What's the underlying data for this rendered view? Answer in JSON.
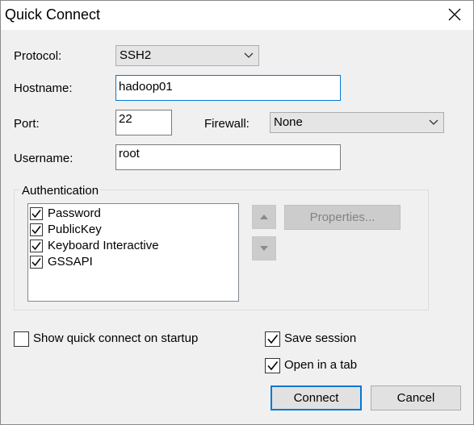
{
  "window": {
    "title": "Quick Connect"
  },
  "form": {
    "protocol_label": "Protocol:",
    "protocol_value": "SSH2",
    "hostname_label": "Hostname:",
    "hostname_value": "hadoop01",
    "port_label": "Port:",
    "port_value": "22",
    "firewall_label": "Firewall:",
    "firewall_value": "None",
    "username_label": "Username:",
    "username_value": "root"
  },
  "auth": {
    "group_label": "Authentication",
    "methods": [
      {
        "label": "Password",
        "checked": true
      },
      {
        "label": "PublicKey",
        "checked": true
      },
      {
        "label": "Keyboard Interactive",
        "checked": true
      },
      {
        "label": "GSSAPI",
        "checked": true
      }
    ],
    "properties_label": "Properties..."
  },
  "options": {
    "show_on_startup_label": "Show quick connect on startup",
    "show_on_startup_checked": false,
    "save_session_label": "Save session",
    "save_session_checked": true,
    "open_in_tab_label": "Open in a tab",
    "open_in_tab_checked": true
  },
  "buttons": {
    "connect_label": "Connect",
    "cancel_label": "Cancel"
  },
  "icons": {
    "close": "close-icon",
    "dropdown": "chevron-down-icon",
    "move_up": "triangle-up-icon",
    "move_down": "triangle-down-icon",
    "check": "checkmark-icon"
  },
  "colors": {
    "accent": "#0078d7",
    "window_bg": "#f0f0f0"
  }
}
